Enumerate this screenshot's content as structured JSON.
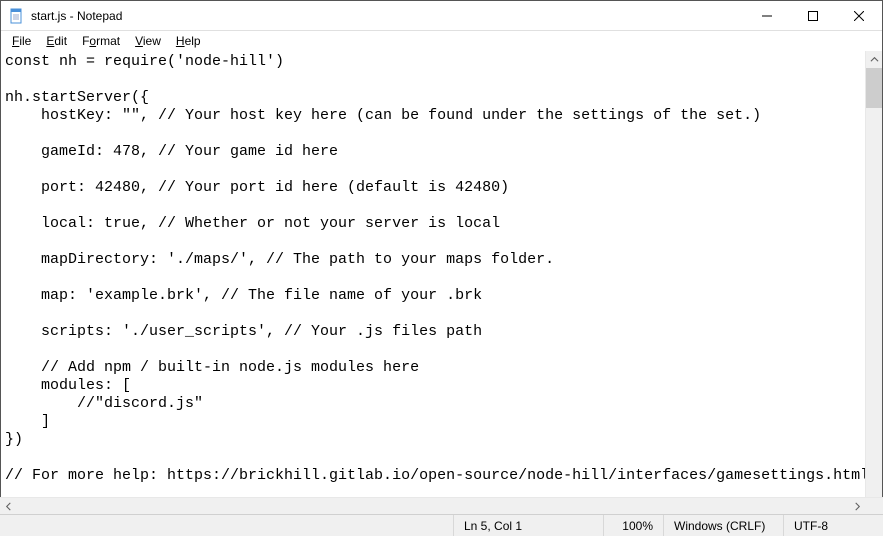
{
  "title": "start.js - Notepad",
  "menu": {
    "file": "File",
    "edit": "Edit",
    "format": "Format",
    "view": "View",
    "help": "Help"
  },
  "editor_content": "const nh = require('node-hill')\n\nnh.startServer({\n    hostKey: \"\", // Your host key here (can be found under the settings of the set.)\n\n    gameId: 478, // Your game id here\n\n    port: 42480, // Your port id here (default is 42480)\n\n    local: true, // Whether or not your server is local\n\n    mapDirectory: './maps/', // The path to your maps folder.\n\n    map: 'example.brk', // The file name of your .brk\n\n    scripts: './user_scripts', // Your .js files path\n\n    // Add npm / built-in node.js modules here\n    modules: [\n        //\"discord.js\"\n    ]\n})\n\n// For more help: https://brickhill.gitlab.io/open-source/node-hill/interfaces/gamesettings.html",
  "status": {
    "position": "Ln 5, Col 1",
    "zoom": "100%",
    "line_ending": "Windows (CRLF)",
    "encoding": "UTF-8"
  }
}
